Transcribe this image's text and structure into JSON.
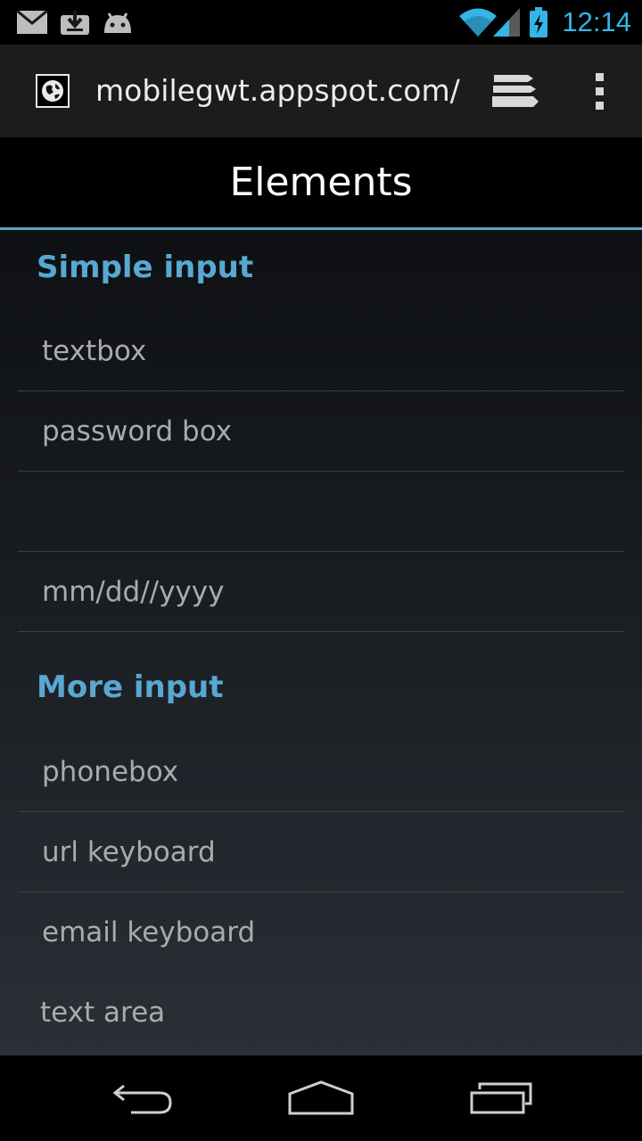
{
  "status_bar": {
    "clock": "12:14",
    "icons": [
      "gmail-icon",
      "download-icon",
      "android-icon",
      "wifi-icon",
      "signal-icon",
      "battery-charging-icon"
    ],
    "accent_color": "#33b5e5"
  },
  "browser": {
    "url": "mobilegwt.appspot.com/",
    "favicon": "globe-icon",
    "tabs_icon": "tabs-icon",
    "menu_icon": "overflow-menu-icon"
  },
  "page": {
    "title": "Elements",
    "accent_color": "#5aa2c8",
    "sections": [
      {
        "header": "Simple input",
        "fields": [
          {
            "placeholder": "textbox"
          },
          {
            "placeholder": "password box"
          },
          {
            "placeholder": ""
          },
          {
            "placeholder": "mm/dd//yyyy"
          }
        ]
      },
      {
        "header": "More input",
        "fields": [
          {
            "placeholder": "phonebox"
          },
          {
            "placeholder": "url keyboard"
          },
          {
            "placeholder": "email keyboard"
          },
          {
            "placeholder": "text area"
          }
        ]
      }
    ]
  },
  "nav_bar": {
    "back": "back-icon",
    "home": "home-icon",
    "recents": "recent-apps-icon"
  }
}
